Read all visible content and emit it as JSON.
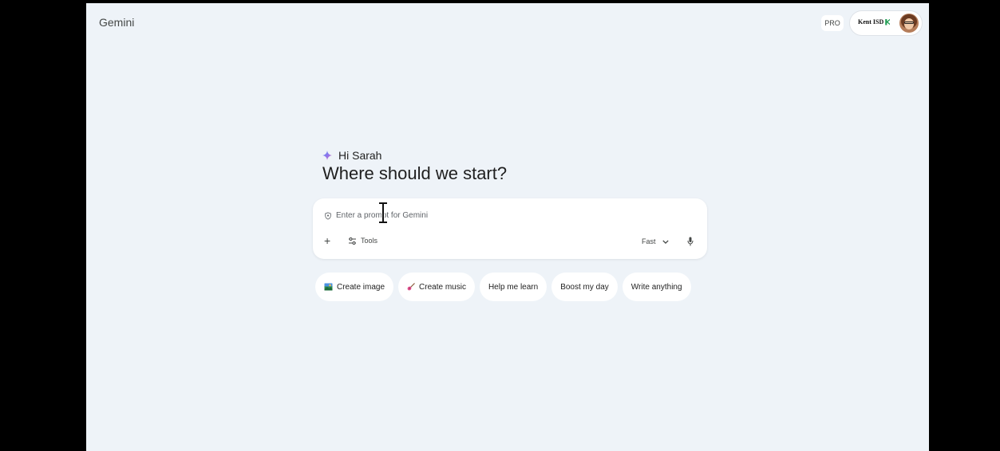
{
  "app": {
    "brand": "Gemini",
    "pro_label": "PRO"
  },
  "account": {
    "org_name": "Kent ISD"
  },
  "home": {
    "greeting": "Hi Sarah",
    "headline": "Where should we start?"
  },
  "prompt": {
    "placeholder": "Enter a prompt for Gemini",
    "add_label": "+",
    "tools_label": "Tools",
    "mode_label": "Fast"
  },
  "chips": [
    {
      "label": "Create image",
      "icon": "image-icon"
    },
    {
      "label": "Create music",
      "icon": "guitar-icon"
    },
    {
      "label": "Help me learn"
    },
    {
      "label": "Boost my day"
    },
    {
      "label": "Write anything"
    }
  ],
  "colors": {
    "background": "#eef3f8",
    "surface": "#ffffff",
    "text": "#1f1f1f",
    "muted": "#5f6368",
    "spark_start": "#4f8df7",
    "spark_end": "#e8556a",
    "org_green": "#1e9c52"
  }
}
